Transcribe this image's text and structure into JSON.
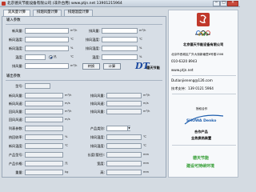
{
  "window": {
    "title": "北京德天节能设备有限公司    (非外台用)  www.ptjn.net   13901215964",
    "min_label": "─",
    "max_label": "□",
    "close_label": "✕"
  },
  "tabs": [
    {
      "label": "双风量计算"
    },
    {
      "label": "排烟风量计算"
    },
    {
      "label": "排烟温度计算"
    }
  ],
  "input_section": {
    "title": "输入参数",
    "left_fields": [
      {
        "label": "新风量:",
        "value": "",
        "unit": "m³/h"
      },
      {
        "label": "新风温度:",
        "value": "",
        "unit": "℃"
      },
      {
        "label": "新风湿度:",
        "value": "",
        "unit": "%"
      },
      {
        "label": "温度:",
        "value": "",
        "unit": "℃"
      },
      {
        "label": "排风量:",
        "value": "",
        "unit": "m³/h"
      }
    ],
    "right_fields": [
      {
        "label": "排风量:",
        "value": "",
        "unit": "m³/h"
      },
      {
        "label": "排风温度:",
        "value": "",
        "unit": "℃"
      },
      {
        "label": "排风湿度:",
        "value": "",
        "unit": "%"
      },
      {
        "label": "温度:",
        "value": "",
        "unit": "%"
      }
    ],
    "radio_label": "热",
    "button_label": "转换",
    "calc_button_label": "计算"
  },
  "output_section": {
    "title": "输出参数",
    "model_label": "型号:",
    "model_value": "",
    "left_rows": [
      {
        "label": "新风风量:",
        "value": ""
      },
      {
        "label": "新风风速:",
        "value": ""
      },
      {
        "label": "回风风量:",
        "value": ""
      },
      {
        "label": "回风风速:",
        "value": ""
      },
      {
        "label": "列表参数:",
        "value": ""
      },
      {
        "label": "热回收率:",
        "value": ""
      },
      {
        "label": "新风温度:",
        "value": ""
      },
      {
        "label": "产品型号:",
        "value": ""
      },
      {
        "label": "产品价格:",
        "value": ""
      },
      {
        "label": "重量:",
        "value": ""
      }
    ],
    "left_units": [
      "m³/h",
      "m/s",
      "m³/h",
      "m/s",
      "",
      "%",
      "℃",
      "",
      "元",
      "kg"
    ],
    "right_rows": [
      {
        "label": "排风风量:",
        "value": ""
      },
      {
        "label": "排风风速:",
        "value": ""
      },
      {
        "label": "排风风量:",
        "value": ""
      },
      {
        "label": "产品类别:",
        "value": ""
      },
      {
        "label": "排风温度:",
        "value": ""
      },
      {
        "label": "排风温度:",
        "value": ""
      },
      {
        "label": "长度(管径):",
        "value": ""
      },
      {
        "label": "宽度:",
        "value": ""
      },
      {
        "label": "高:",
        "value": ""
      }
    ],
    "right_units": [
      "m³/h",
      "m/s",
      "m³/h",
      "",
      "℃",
      "℃",
      "mm",
      "mm",
      "mm"
    ]
  },
  "logo": {
    "mark": "DT",
    "name": "德天节能"
  },
  "right_panel": {
    "olympic_logo": "Beijing 2008",
    "company": "北京德天节能设备有限公司",
    "address_1": "北京市西城区广外大街新塘里6号楼1506",
    "phone": "010-6320 8943",
    "website": "www.ptjn.net",
    "email": "Dutianjieneng@126.com",
    "tech": "技术支持：139 0121 5964",
    "partner_label": "授权合作",
    "partner_name": "SHOWA Denko",
    "partner_sub": "合作产品",
    "partner_product": "全热换热装置",
    "slogan_1": "德天节能",
    "slogan_2": "建设可持续环境"
  },
  "colors": {
    "window_bg": "#d4dbe2",
    "accent_blue": "#1d4aa0",
    "olympic_red": "#c0392b",
    "showa_blue": "#1f5fae",
    "slogan_green": "#2e9b2e"
  }
}
